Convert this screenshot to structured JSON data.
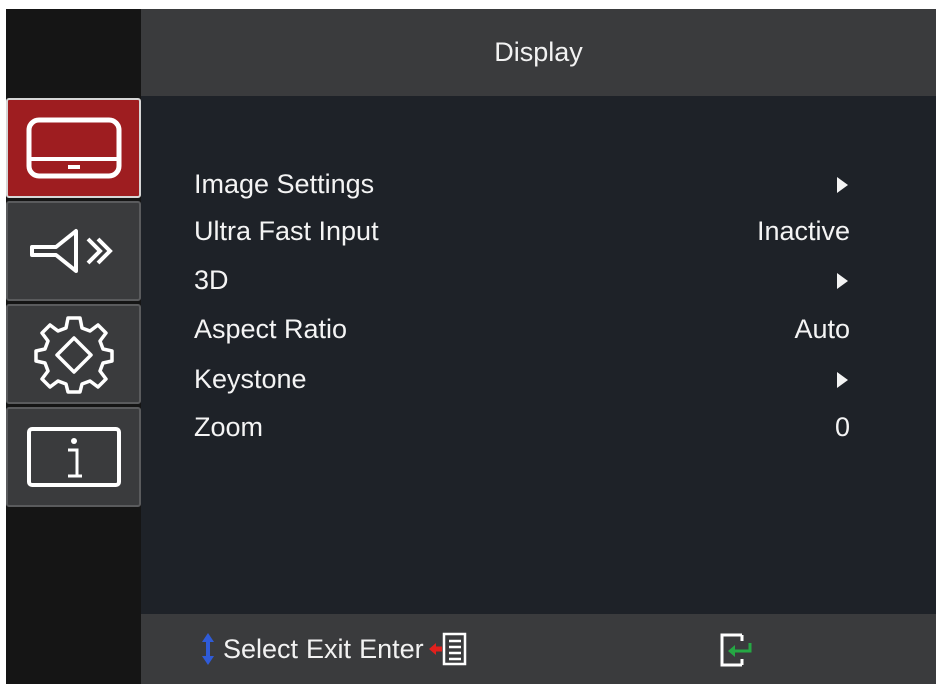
{
  "header": {
    "title": "Display"
  },
  "sidebar": {
    "tabs": [
      {
        "name": "display",
        "icon": "display-icon",
        "active": true
      },
      {
        "name": "audio",
        "icon": "speaker-icon",
        "active": false
      },
      {
        "name": "setup",
        "icon": "gear-icon",
        "active": false
      },
      {
        "name": "information",
        "icon": "info-icon",
        "active": false
      }
    ]
  },
  "menu": {
    "items": [
      {
        "label": "Image Settings",
        "value": "",
        "submenu": true
      },
      {
        "label": "Ultra Fast Input",
        "value": "Inactive",
        "submenu": false
      },
      {
        "label": "3D",
        "value": "",
        "submenu": true
      },
      {
        "label": "Aspect Ratio",
        "value": "Auto",
        "submenu": false
      },
      {
        "label": "Keystone",
        "value": "",
        "submenu": true
      },
      {
        "label": "Zoom",
        "value": "0",
        "submenu": false
      }
    ]
  },
  "footer": {
    "select_label": "Select",
    "exit_label": "Exit",
    "enter_label": "Enter",
    "icons": [
      "updown-arrow-icon",
      "exit-menu-icon",
      "enter-icon"
    ]
  },
  "colors": {
    "active_tab": "#9e1d20",
    "panel": "#1e2228",
    "bar": "#3a3b3d",
    "select_arrow": "#2f5bd8",
    "exit_arrow": "#e0201d",
    "enter_arrow": "#25a844"
  }
}
